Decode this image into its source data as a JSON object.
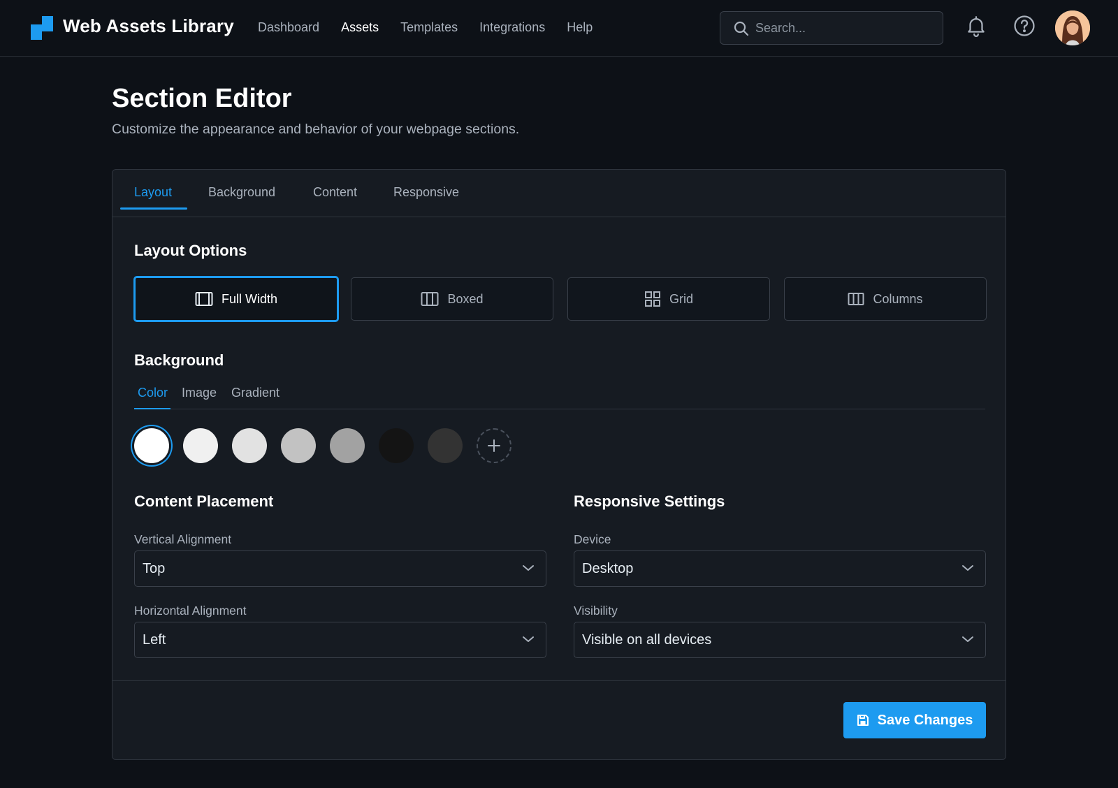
{
  "app": {
    "brand": "Web Assets Library",
    "accent_color": "#1d9bf0"
  },
  "nav": {
    "items": [
      {
        "label": "Dashboard",
        "active": false
      },
      {
        "label": "Assets",
        "active": true
      },
      {
        "label": "Templates",
        "active": false
      },
      {
        "label": "Integrations",
        "active": false
      },
      {
        "label": "Help",
        "active": false
      }
    ]
  },
  "search": {
    "placeholder": "Search...",
    "icon": "search-icon"
  },
  "header_icons": [
    "bell-icon",
    "help-circle-icon"
  ],
  "page": {
    "title": "Section Editor",
    "subtitle": "Customize the appearance and behavior of your webpage sections."
  },
  "tabs": [
    {
      "label": "Layout",
      "active": true
    },
    {
      "label": "Background",
      "active": false
    },
    {
      "label": "Content",
      "active": false
    },
    {
      "label": "Responsive",
      "active": false
    }
  ],
  "layout_options": {
    "title": "Layout Options",
    "options": [
      {
        "label": "Full Width",
        "icon": "full-width-icon",
        "selected": true
      },
      {
        "label": "Boxed",
        "icon": "boxed-icon",
        "selected": false
      },
      {
        "label": "Grid",
        "icon": "grid-icon",
        "selected": false
      },
      {
        "label": "Columns",
        "icon": "columns-icon",
        "selected": false
      }
    ]
  },
  "background": {
    "title": "Background",
    "subtabs": [
      {
        "label": "Color",
        "active": true
      },
      {
        "label": "Image",
        "active": false
      },
      {
        "label": "Gradient",
        "active": false
      }
    ],
    "swatches": [
      "#ffffff",
      "#f0f0f0",
      "#e2e2e2",
      "#c2c2c2",
      "#a2a2a2",
      "#141414",
      "#333333"
    ],
    "selected_swatch": "#ffffff"
  },
  "content_placement": {
    "title": "Content Placement",
    "vertical_label": "Vertical Alignment",
    "vertical_value": "Top",
    "horizontal_label": "Horizontal Alignment",
    "horizontal_value": "Left"
  },
  "responsive": {
    "title": "Responsive Settings",
    "device_label": "Device",
    "device_value": "Desktop",
    "visibility_label": "Visibility",
    "visibility_value": "Visible on all devices"
  },
  "actions": {
    "save_label": "Save Changes"
  }
}
